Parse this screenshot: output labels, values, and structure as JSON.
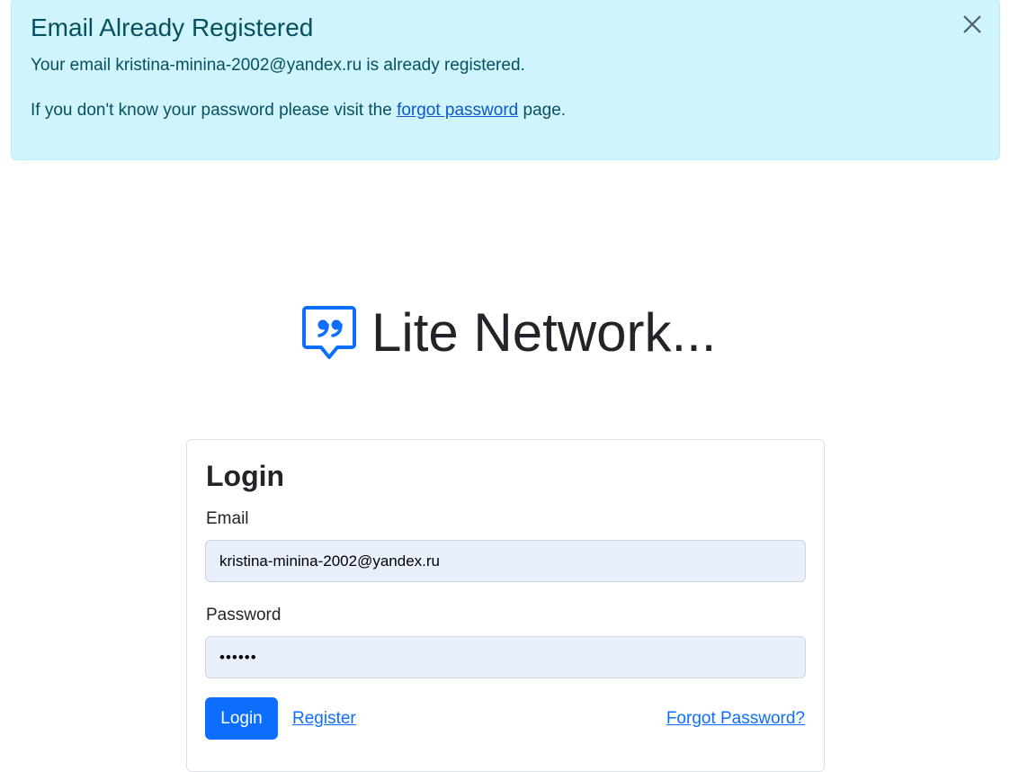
{
  "alert": {
    "heading": "Email Already Registered",
    "line1": "Your email kristina-minina-2002@yandex.ru is already registered.",
    "line2_before": "If you don't know your password please visit the ",
    "line2_link": "forgot password",
    "line2_after": " page.",
    "close_icon": "close-icon",
    "colors": {
      "background": "#cff4fc",
      "border": "#b6effb",
      "text": "#055160"
    }
  },
  "brand": {
    "icon": "quote-chat-icon",
    "title": "Lite Network...",
    "accent": "#0d6efd"
  },
  "login_card": {
    "title": "Login",
    "email_label": "Email",
    "email_value": "kristina-minina-2002@yandex.ru",
    "password_label": "Password",
    "password_value": "••••••",
    "login_button": "Login",
    "register_link": "Register",
    "forgot_link": "Forgot Password?",
    "colors": {
      "primary": "#0d6efd",
      "input_bg": "#e8f0fe"
    }
  }
}
